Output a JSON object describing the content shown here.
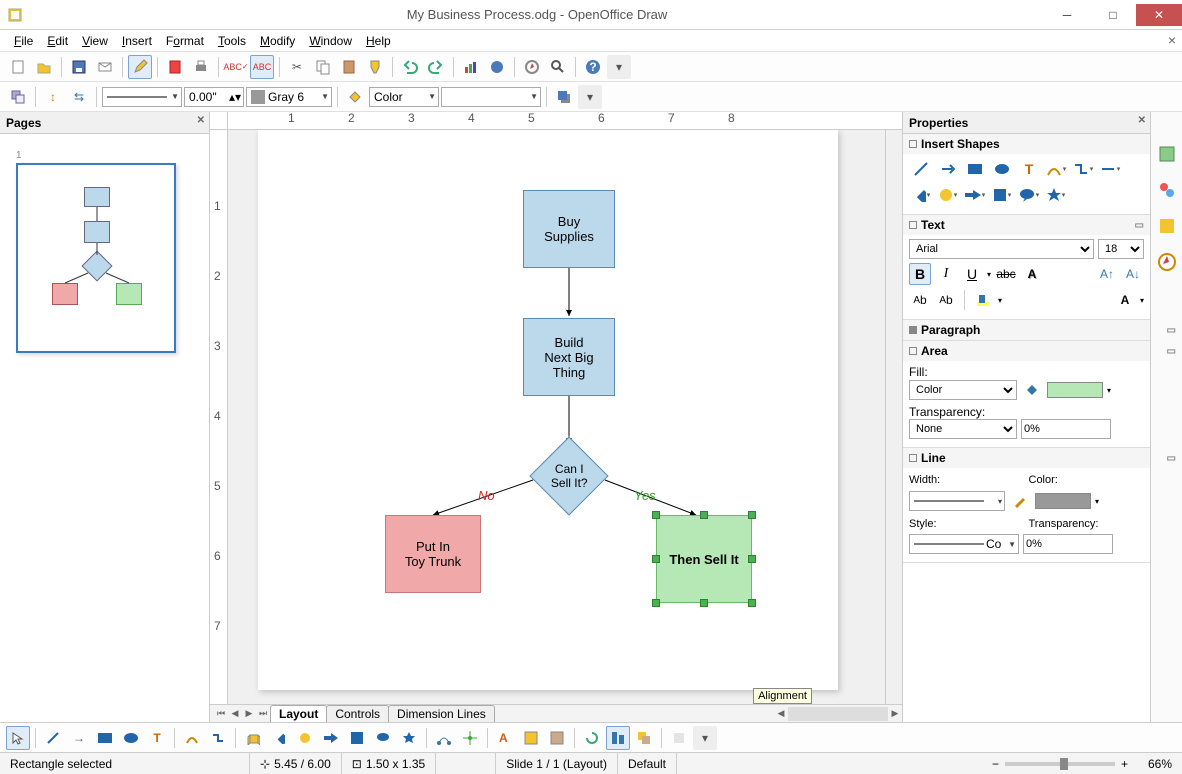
{
  "window": {
    "title": "My Business Process.odg - OpenOffice Draw"
  },
  "menus": [
    "File",
    "Edit",
    "View",
    "Insert",
    "Format",
    "Tools",
    "Modify",
    "Window",
    "Help"
  ],
  "toolbar2": {
    "line_width": "0.00\"",
    "line_color_label": "Gray 6",
    "fill_type": "Color"
  },
  "pages_panel": {
    "title": "Pages",
    "page_num": "1"
  },
  "canvas": {
    "box1": "Buy\nSupplies",
    "box2": "Build\nNext Big\nThing",
    "decision": "Can I\nSell It?",
    "no_label": "No",
    "yes_label": "Yes",
    "left_box": "Put In\nToy Trunk",
    "right_box": "Then Sell It",
    "tooltip": "Alignment"
  },
  "tabs": {
    "layout": "Layout",
    "controls": "Controls",
    "dimension": "Dimension Lines"
  },
  "properties": {
    "title": "Properties",
    "sections": {
      "shapes": "Insert Shapes",
      "text": "Text",
      "paragraph": "Paragraph",
      "area": "Area",
      "line": "Line"
    },
    "font_name": "Arial",
    "font_size": "18",
    "fill_label": "Fill:",
    "fill_type": "Color",
    "transparency_label": "Transparency:",
    "transparency_type": "None",
    "transparency_val": "0%",
    "line_width_label": "Width:",
    "line_color_label": "Color:",
    "line_style_label": "Style:",
    "line_style_val": "Co",
    "line_transp_val": "0%"
  },
  "status": {
    "selection": "Rectangle selected",
    "pos": "5.45 / 6.00",
    "size": "1.50 x 1.35",
    "slide": "Slide 1 / 1 (Layout)",
    "style": "Default",
    "zoom": "66%"
  }
}
